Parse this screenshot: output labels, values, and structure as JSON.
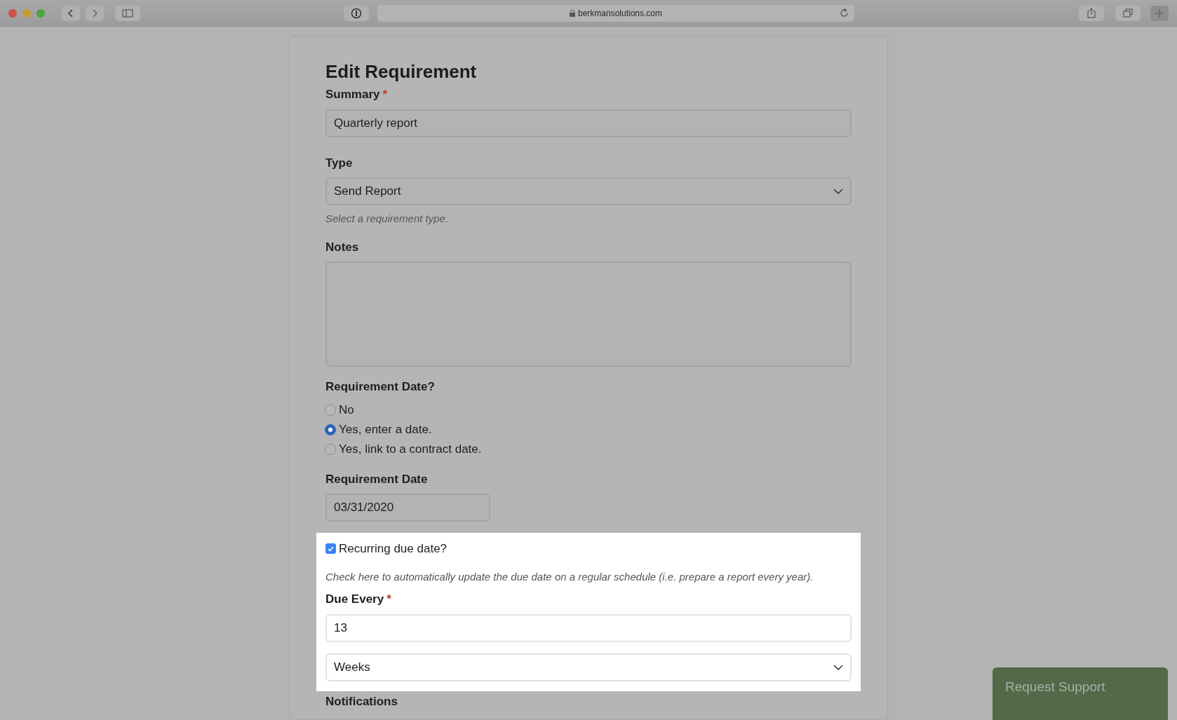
{
  "browser": {
    "url": "berkmansolutions.com"
  },
  "form": {
    "title": "Edit Requirement",
    "summary": {
      "label": "Summary",
      "required_mark": "*",
      "value": "Quarterly report"
    },
    "type": {
      "label": "Type",
      "value": "Send Report",
      "help": "Select a requirement type."
    },
    "notes": {
      "label": "Notes"
    },
    "date_choice": {
      "label": "Requirement Date?",
      "options": [
        {
          "label": "No",
          "selected": false
        },
        {
          "label": "Yes, enter a date.",
          "selected": true
        },
        {
          "label": "Yes, link to a contract date.",
          "selected": false
        }
      ]
    },
    "requirement_date": {
      "label": "Requirement Date",
      "value": "03/31/2020"
    },
    "recurring": {
      "label": "Recurring due date?",
      "checked": true,
      "help": "Check here to automatically update the due date on a regular schedule (i.e. prepare a report every year)."
    },
    "due_every": {
      "label": "Due Every",
      "required_mark": "*",
      "value": "13",
      "unit": "Weeks"
    },
    "notifications": {
      "label": "Notifications"
    }
  },
  "support_button": "Request Support"
}
